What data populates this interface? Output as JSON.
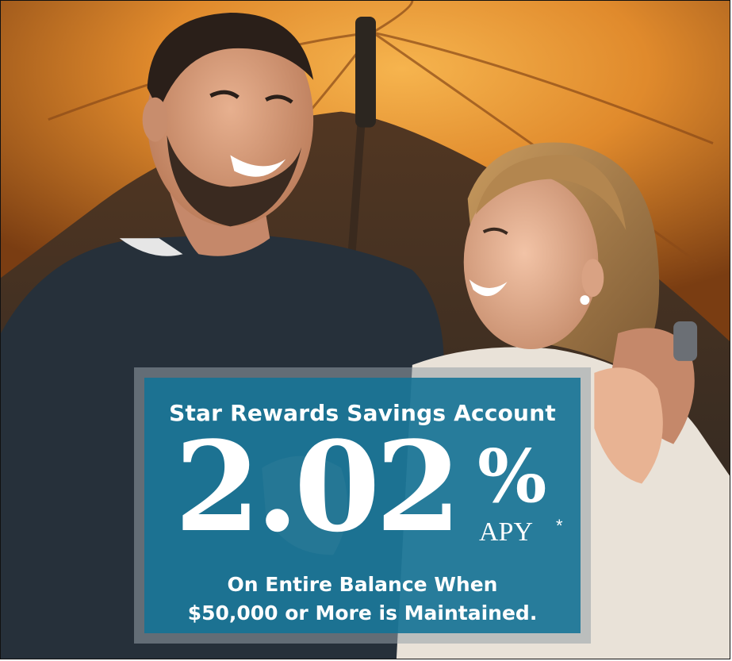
{
  "promo": {
    "headline": "Star Rewards Savings Account",
    "rate": "2.02",
    "percent_sign": "%",
    "apy_label": "APY",
    "asterisk": "*",
    "line1": "On Entire Balance When",
    "line2": "$50,000 or More is Maintained."
  },
  "colors": {
    "panel": "#12739a",
    "umbrella": "#e98a2a",
    "text": "#ffffff"
  }
}
